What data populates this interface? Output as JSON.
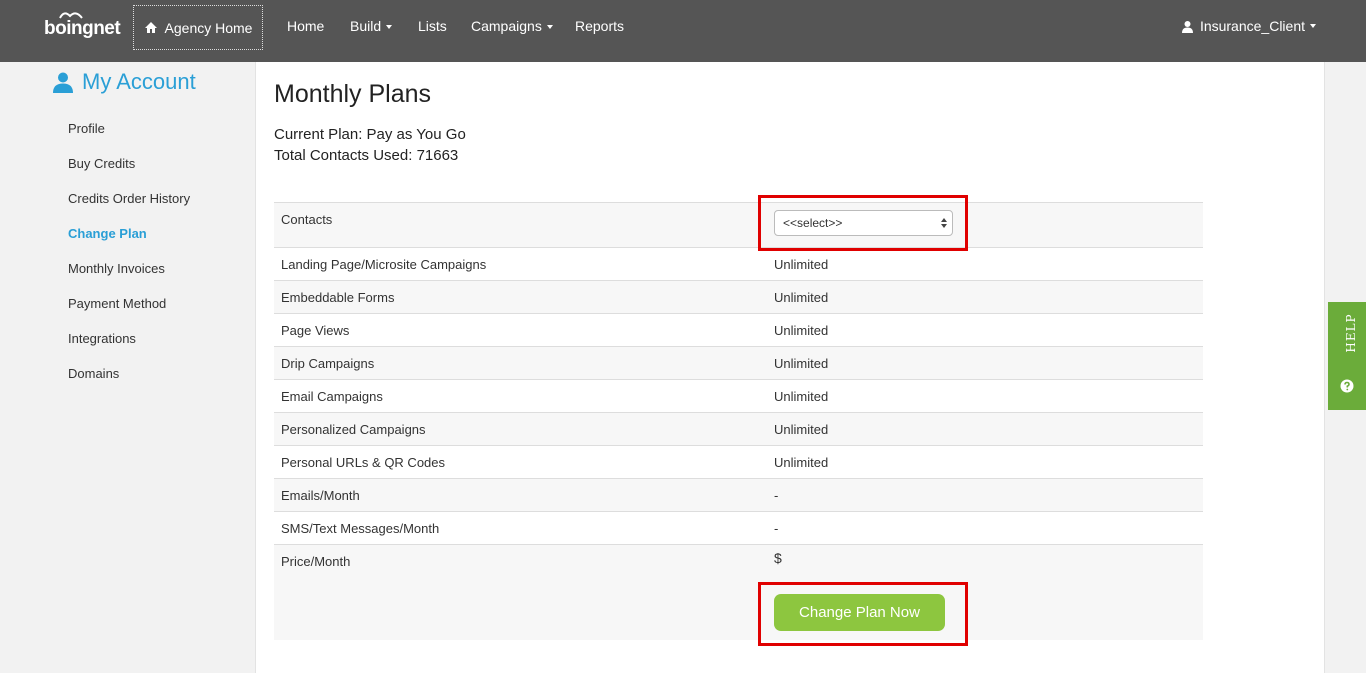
{
  "header": {
    "logo_text": "boingnet",
    "agency_home": "Agency Home",
    "nav": [
      {
        "label": "Home"
      },
      {
        "label": "Build"
      },
      {
        "label": "Lists"
      },
      {
        "label": "Campaigns"
      },
      {
        "label": "Reports"
      }
    ],
    "user": "Insurance_Client"
  },
  "sidebar": {
    "title": "My Account",
    "items": [
      {
        "label": "Profile"
      },
      {
        "label": "Buy Credits"
      },
      {
        "label": "Credits Order History"
      },
      {
        "label": "Change Plan",
        "active": true
      },
      {
        "label": "Monthly Invoices"
      },
      {
        "label": "Payment Method"
      },
      {
        "label": "Integrations"
      },
      {
        "label": "Domains"
      }
    ]
  },
  "main": {
    "title": "Monthly Plans",
    "current_plan": "Current Plan: Pay as You Go",
    "contacts_used": "Total Contacts Used: 71663",
    "contacts_label": "Contacts",
    "contacts_select": "<<select>>",
    "rows": [
      {
        "label": "Landing Page/Microsite Campaigns",
        "value": "Unlimited"
      },
      {
        "label": "Embeddable Forms",
        "value": "Unlimited"
      },
      {
        "label": "Page Views",
        "value": "Unlimited"
      },
      {
        "label": "Drip Campaigns",
        "value": "Unlimited"
      },
      {
        "label": "Email Campaigns",
        "value": "Unlimited"
      },
      {
        "label": "Personalized Campaigns",
        "value": "Unlimited"
      },
      {
        "label": "Personal URLs & QR Codes",
        "value": "Unlimited"
      },
      {
        "label": "Emails/Month",
        "value": "-"
      },
      {
        "label": "SMS/Text Messages/Month",
        "value": "-"
      }
    ],
    "price_label": "Price/Month",
    "price_value": "$",
    "change_button": "Change Plan Now"
  },
  "help_tab": "HELP",
  "colors": {
    "topbar": "#555555",
    "accent_blue": "#2a9fd6",
    "button_green": "#8dc63f",
    "help_green": "#6bac3a",
    "highlight_red": "#e00000"
  }
}
